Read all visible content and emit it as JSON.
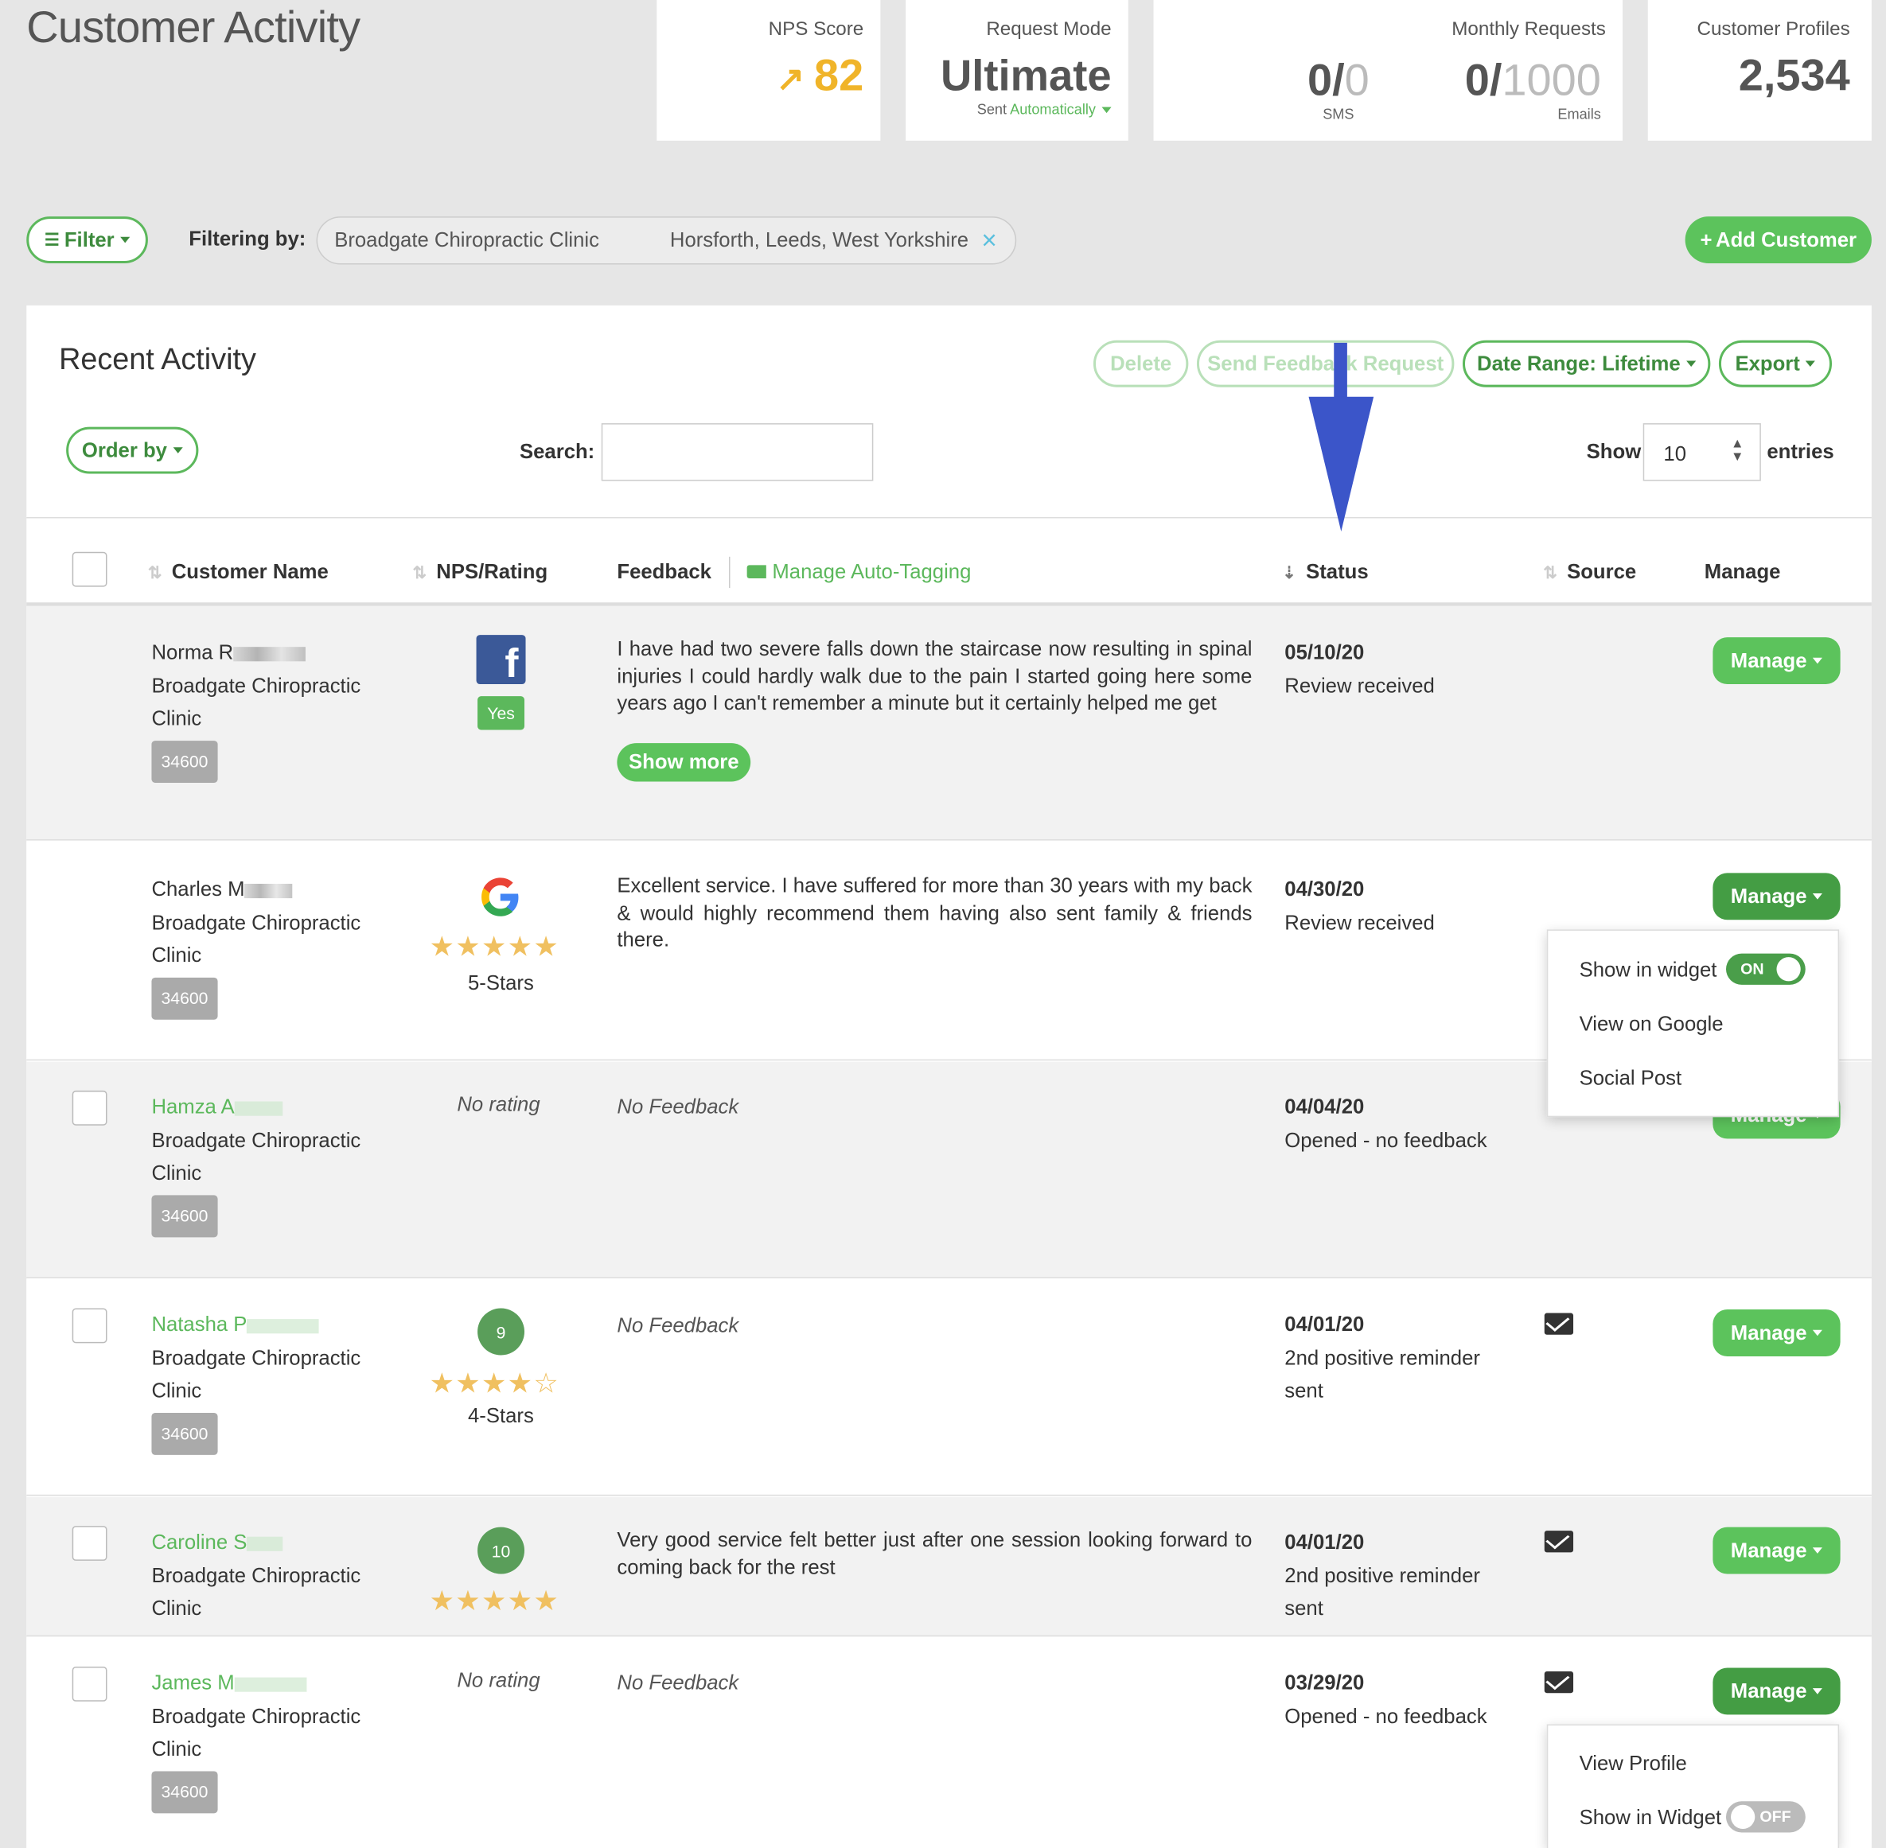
{
  "page": {
    "title": "Customer Activity"
  },
  "stats": {
    "nps": {
      "label": "NPS Score",
      "value": "82"
    },
    "mode": {
      "label": "Request Mode",
      "value": "Ultimate",
      "sub_prefix": "Sent ",
      "sub_link": "Automatically"
    },
    "monthly": {
      "label": "Monthly Requests",
      "sms_used": "0/",
      "sms_limit": "0",
      "sms_label": "SMS",
      "email_used": "0/",
      "email_limit": "1000",
      "email_label": "Emails"
    },
    "profiles": {
      "label": "Customer Profiles",
      "value": "2,534"
    }
  },
  "filterbar": {
    "filter_label": "Filter",
    "filtering_by": "Filtering by:",
    "chip_name": "Broadgate Chiropractic Clinic",
    "chip_location": "Horsforth, Leeds, West Yorkshire",
    "add_customer": "Add Customer"
  },
  "panel": {
    "title": "Recent Activity",
    "delete": "Delete",
    "send_request": "Send Feedback Request",
    "date_range": "Date Range: Lifetime",
    "export": "Export",
    "order_by": "Order by",
    "search_label": "Search:",
    "search_value": "",
    "show_label": "Show",
    "show_value": "10",
    "entries_label": "entries"
  },
  "columns": {
    "name": "Customer Name",
    "rating": "NPS/Rating",
    "feedback": "Feedback",
    "auto_tag": "Manage Auto-Tagging",
    "status": "Status",
    "source": "Source",
    "manage": "Manage"
  },
  "rows": [
    {
      "first": "Norma R",
      "clinic1": "Broadgate Chiropractic",
      "clinic2": "Clinic",
      "code": "34600",
      "rating_badge": "Yes",
      "feedback": "I have had two severe falls down the staircase now resulting in spinal injuries I could hardly walk due to the pain I started going here some years ago I can't remember a minute but it certainly helped me get",
      "show_more": "Show more",
      "date": "05/10/20",
      "status": "Review received",
      "manage": "Manage"
    },
    {
      "first": "Charles M",
      "clinic1": "Broadgate Chiropractic",
      "clinic2": "Clinic",
      "code": "34600",
      "stars_text": "5-Stars",
      "stars": 5,
      "feedback": "Excellent service. I have suffered for more than 30 years with my back & would highly recommend them having also sent family & friends there.",
      "date": "04/30/20",
      "status": "Review received",
      "manage": "Manage"
    },
    {
      "first": "Hamza A",
      "clinic1": "Broadgate Chiropractic",
      "clinic2": "Clinic",
      "code": "34600",
      "no_rating": "No rating",
      "feedback": "No Feedback",
      "date": "04/04/20",
      "status": "Opened - no feedback",
      "manage": "Manage"
    },
    {
      "first": "Natasha P",
      "clinic1": "Broadgate Chiropractic",
      "clinic2": "Clinic",
      "code": "34600",
      "nps": "9",
      "stars": 4,
      "stars_text": "4-Stars",
      "feedback": "No Feedback",
      "date": "04/01/20",
      "status1": "2nd positive reminder",
      "status2": "sent",
      "manage": "Manage"
    },
    {
      "first": "Caroline S",
      "clinic1": "Broadgate Chiropractic",
      "clinic2": "Clinic",
      "nps": "10",
      "stars": 5,
      "feedback": "Very good service felt better just after one session looking forward to coming back for the rest",
      "date": "04/01/20",
      "status1": "2nd positive reminder",
      "status2": "sent",
      "manage": "Manage"
    },
    {
      "first": "James M",
      "clinic1": "Broadgate Chiropractic",
      "clinic2": "Clinic",
      "code": "34600",
      "no_rating": "No rating",
      "feedback": "No Feedback",
      "date": "03/29/20",
      "status": "Opened - no feedback",
      "manage": "Manage"
    }
  ],
  "menu1": {
    "show_widget": "Show in widget",
    "toggle": "ON",
    "view_google": "View on Google",
    "social_post": "Social Post"
  },
  "menu2": {
    "view_profile": "View Profile",
    "show_widget": "Show in Widget",
    "toggle": "OFF"
  },
  "colors": {
    "brand_green": "#5cc35c",
    "nps_yellow": "#f0b429",
    "arrow_blue": "#3b55c9"
  }
}
